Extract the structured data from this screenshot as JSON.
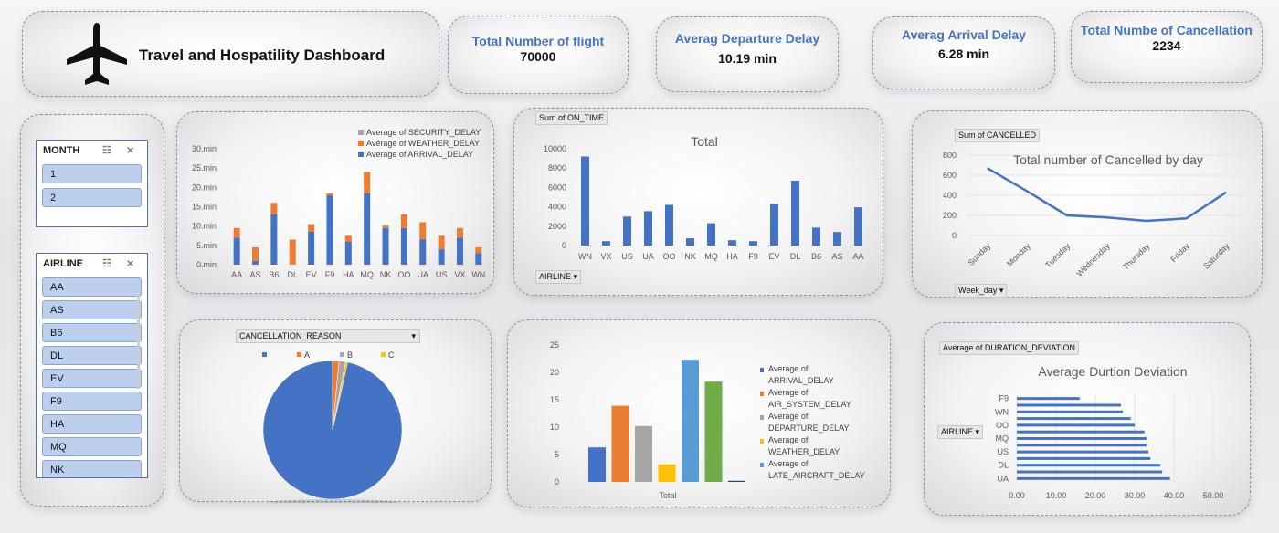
{
  "header": {
    "title": "Travel and Hospatility Dashboard",
    "icon": "airplane-icon"
  },
  "kpis": [
    {
      "title": "Total Number of flight",
      "value": "70000"
    },
    {
      "title": "Averag Departure Delay",
      "value": "10.19 min"
    },
    {
      "title": "Averag  Arrival Delay",
      "value": "6.28 min"
    },
    {
      "title": "Total Numbe of Cancellation",
      "value": "2234"
    }
  ],
  "slicers": {
    "month": {
      "title": "MONTH",
      "items": [
        "1",
        "2"
      ]
    },
    "airline": {
      "title": "AIRLINE",
      "items": [
        "AA",
        "AS",
        "B6",
        "DL",
        "EV",
        "F9",
        "HA",
        "MQ",
        "NK"
      ]
    }
  },
  "colors": {
    "blue": "#4472c4",
    "orange": "#ed7d31",
    "gray": "#a5a5a5",
    "gold": "#ffc000",
    "lightblue": "#5b9bd5",
    "green": "#70ad47",
    "navy": "#264478"
  },
  "chart_delay": {
    "field_label": "",
    "chart_data": {
      "type": "bar",
      "stacked": true,
      "categories": [
        "AA",
        "AS",
        "B6",
        "DL",
        "EV",
        "F9",
        "HA",
        "MQ",
        "NK",
        "OO",
        "UA",
        "US",
        "VX",
        "WN"
      ],
      "series": [
        {
          "name": "Average of ARRIVAL_DELAY",
          "values": [
            7,
            1,
            13,
            0,
            8.5,
            18,
            6,
            18.5,
            9.5,
            9.5,
            6.5,
            4,
            7,
            3
          ]
        },
        {
          "name": "Average of WEATHER_DELAY",
          "values": [
            2.5,
            3.5,
            3,
            6.5,
            2,
            0.5,
            1.5,
            5.5,
            0.5,
            3.5,
            4.5,
            3.5,
            2.5,
            1.5
          ]
        },
        {
          "name": "Average of SECURITY_DELAY",
          "values": [
            0,
            0,
            0,
            0,
            0,
            0,
            0,
            0,
            0.3,
            0,
            0,
            0,
            0,
            0
          ]
        }
      ],
      "yticks": [
        "0.min",
        "5.min",
        "10.min",
        "15.min",
        "20.min",
        "25.min",
        "30.min"
      ],
      "ylim": [
        0,
        30
      ]
    }
  },
  "chart_ontime": {
    "field_label": "Sum of ON_TIME",
    "axis_field": "AIRLINE",
    "chart_data": {
      "type": "bar",
      "title": "Total",
      "categories": [
        "WN",
        "VX",
        "US",
        "UA",
        "OO",
        "NK",
        "MQ",
        "HA",
        "F9",
        "EV",
        "DL",
        "B6",
        "AS",
        "AA"
      ],
      "values": [
        9200,
        450,
        3000,
        3550,
        4200,
        750,
        2300,
        550,
        450,
        4300,
        6700,
        1850,
        1400,
        3950
      ],
      "yticks": [
        "0",
        "2000",
        "4000",
        "6000",
        "8000",
        "10000"
      ],
      "ylim": [
        0,
        10000
      ]
    }
  },
  "chart_cancel": {
    "field_label": "Sum of CANCELLED",
    "axis_field": "Week_day",
    "chart_data": {
      "type": "line",
      "title": "Total number of Cancelled by day",
      "categories": [
        "Sunday",
        "Monday",
        "Tuesday",
        "Wednesday",
        "Thursday",
        "Friday",
        "Saturday"
      ],
      "values": [
        670,
        440,
        200,
        180,
        145,
        170,
        430
      ],
      "yticks": [
        "0",
        "200",
        "400",
        "600",
        "800"
      ],
      "ylim": [
        0,
        800
      ]
    }
  },
  "chart_pie": {
    "field_label": "CANCELLATION_REASON",
    "chart_data": {
      "type": "pie",
      "categories": [
        "",
        "A",
        "B",
        "C"
      ],
      "values": [
        96.5,
        1.5,
        1.5,
        0.5
      ]
    }
  },
  "chart_delaytypes": {
    "chart_data": {
      "type": "bar",
      "categories": [
        "Total"
      ],
      "series": [
        {
          "name": "Average of ARRIVAL_DELAY",
          "values": [
            6.3
          ]
        },
        {
          "name": "Average of AIR_SYSTEM_DELAY",
          "values": [
            13.9
          ]
        },
        {
          "name": "Average of DEPARTURE_DELAY",
          "values": [
            10.2
          ]
        },
        {
          "name": "Average of WEATHER_DELAY",
          "values": [
            3.2
          ]
        },
        {
          "name": "Average of LATE_AIRCRAFT_DELAY",
          "values": [
            22.3
          ]
        },
        {
          "name": "",
          "values": [
            18.3
          ]
        },
        {
          "name": "",
          "values": [
            0.2
          ]
        }
      ],
      "yticks": [
        "0",
        "5",
        "10",
        "15",
        "20",
        "25"
      ],
      "ylim": [
        0,
        25
      ]
    }
  },
  "chart_duration": {
    "field_label": "Average of DURATION_DEVIATION",
    "axis_field": "AIRLINE",
    "chart_data": {
      "type": "bar",
      "orientation": "horizontal",
      "title": "Average Durtion Deviation",
      "categories": [
        "UA",
        "",
        "DL",
        "",
        "US",
        "",
        "MQ",
        "",
        "OO",
        "",
        "WN",
        "",
        "F9"
      ],
      "values": [
        39,
        37,
        36.5,
        34,
        33.5,
        33,
        33,
        32.5,
        30,
        29,
        27,
        26.5,
        16
      ],
      "xticks": [
        "0.00",
        "10.00",
        "20.00",
        "30.00",
        "40.00",
        "50.00"
      ],
      "xlim": [
        0,
        50
      ]
    }
  }
}
